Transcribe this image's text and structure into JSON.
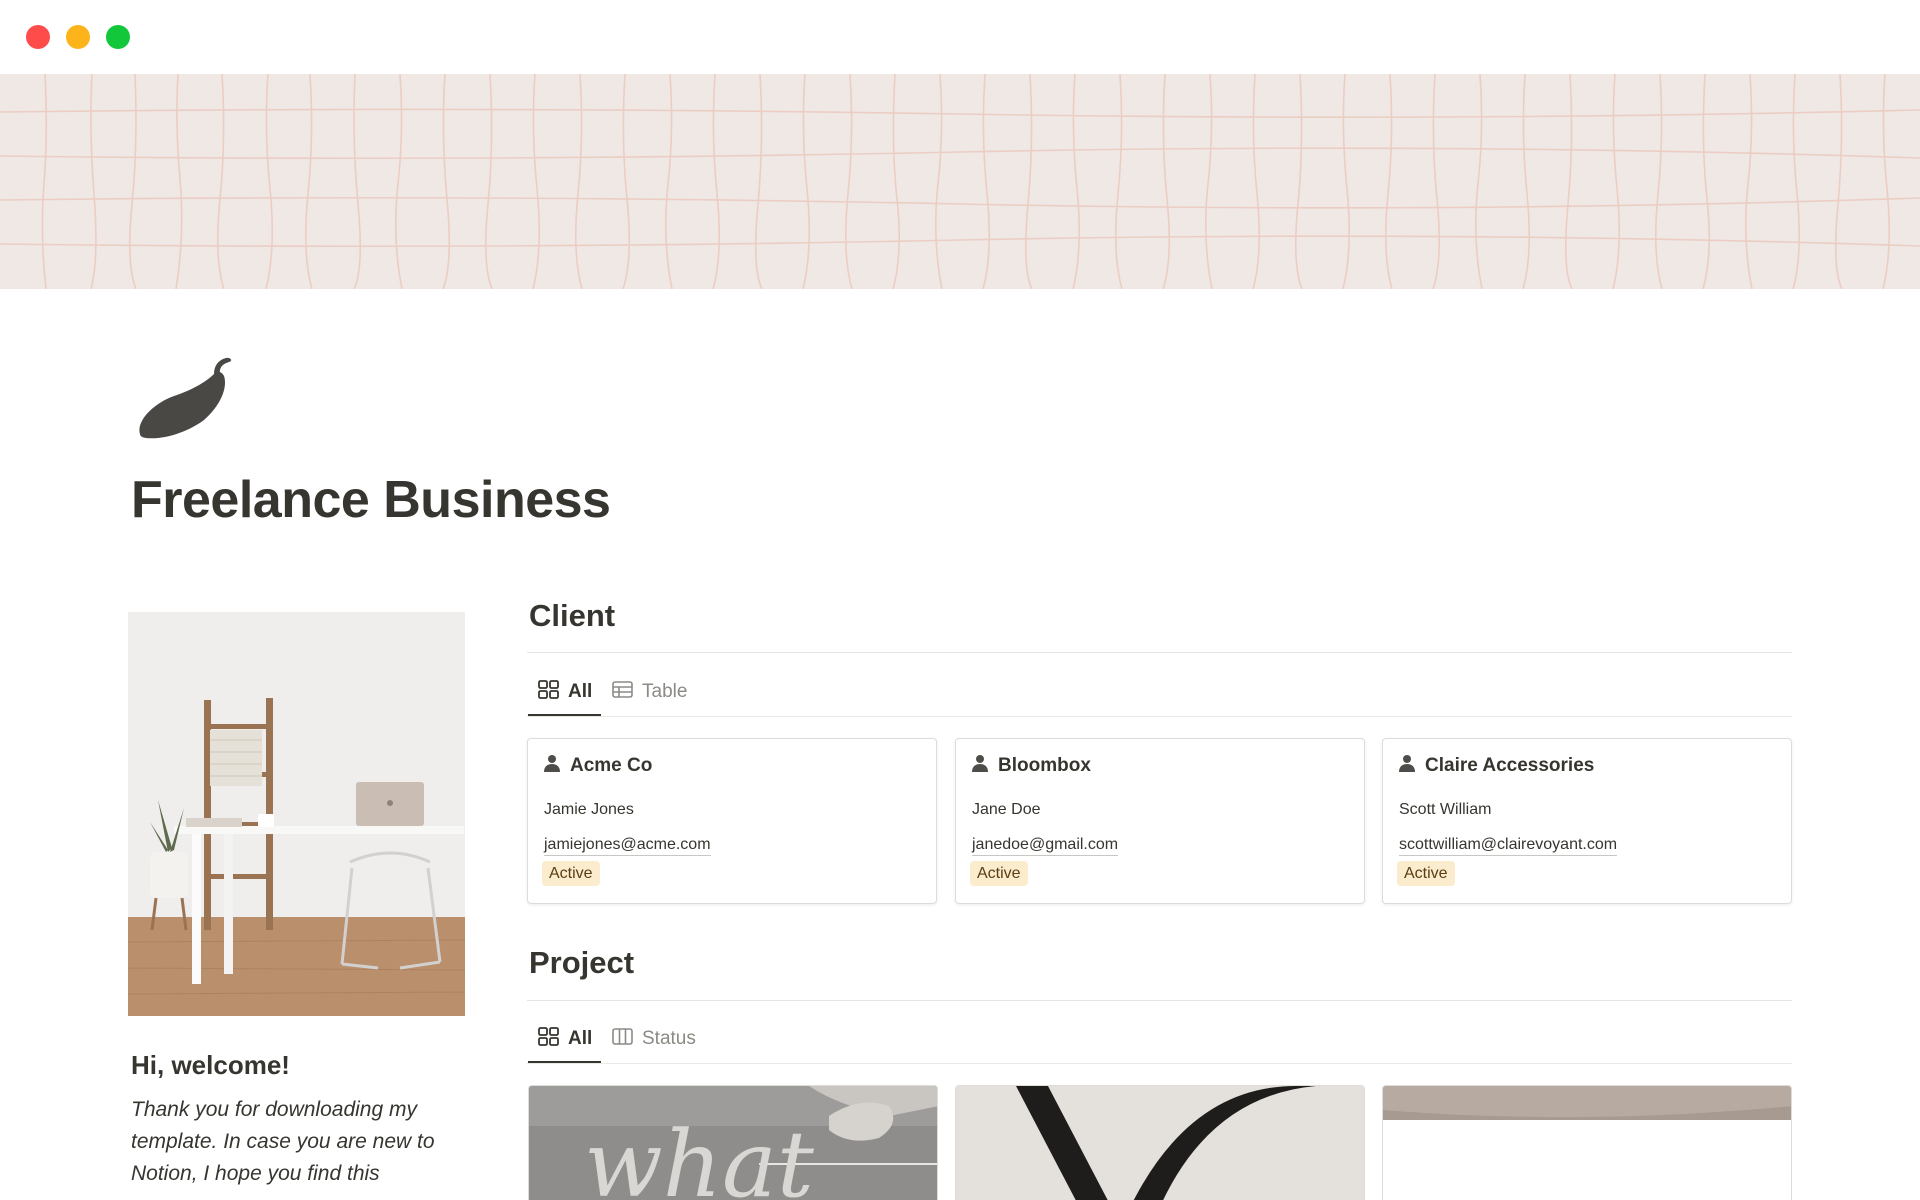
{
  "page": {
    "title": "Freelance Business",
    "icon": "chili-pepper-icon"
  },
  "window": {
    "controls": [
      "close",
      "minimize",
      "maximize"
    ]
  },
  "welcome": {
    "heading": "Hi, welcome!",
    "body": "Thank you for downloading my template. In case you are new to Notion, I hope you find this"
  },
  "client": {
    "heading": "Client",
    "tabs": [
      {
        "label": "All",
        "icon": "gallery-icon",
        "active": true
      },
      {
        "label": "Table",
        "icon": "table-icon",
        "active": false
      }
    ],
    "cards": [
      {
        "name": "Acme Co",
        "contact": "Jamie Jones",
        "email": "jamiejones@acme.com",
        "status": "Active"
      },
      {
        "name": "Bloombox",
        "contact": "Jane Doe",
        "email": "janedoe@gmail.com",
        "status": "Active"
      },
      {
        "name": "Claire Accessories",
        "contact": "Scott William",
        "email": "scottwilliam@clairevoyant.com",
        "status": "Active"
      }
    ]
  },
  "project": {
    "heading": "Project",
    "tabs": [
      {
        "label": "All",
        "icon": "gallery-icon",
        "active": true
      },
      {
        "label": "Status",
        "icon": "board-icon",
        "active": false
      }
    ]
  },
  "colors": {
    "text": "#37352f",
    "badge_bg": "#fbeccd",
    "cover_bg": "#efe8e5"
  }
}
